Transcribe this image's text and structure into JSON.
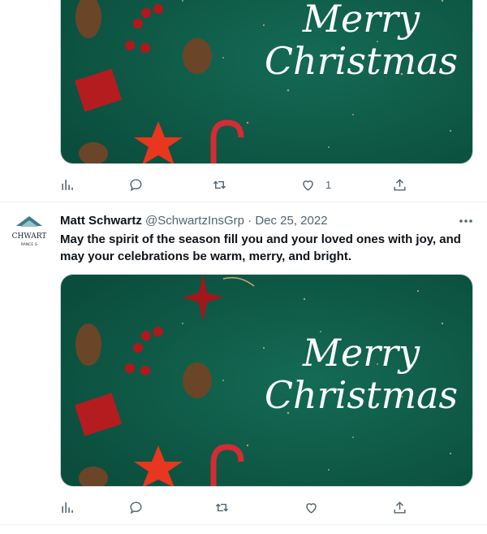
{
  "tweet1": {
    "image_text": [
      "Merry",
      "Christmas"
    ],
    "actions": {
      "analytics_icon": "bar-chart-icon",
      "reply_icon": "speech-bubble-icon",
      "retweet_icon": "retweet-arrows-icon",
      "like_icon": "heart-icon",
      "like_count": "1",
      "share_icon": "upload-arrow-icon"
    }
  },
  "tweet2": {
    "author_name": "Matt Schwartz",
    "handle": "@SchwartzInsGrp",
    "separator": "·",
    "date": "Dec 25, 2022",
    "avatar_text": [
      "CHWART",
      "RANCE G"
    ],
    "text": "May the spirit of the season fill you and your loved ones with joy, and may your celebrations be warm, merry, and bright.",
    "image_text": [
      "Merry",
      "Christmas"
    ],
    "actions": {
      "analytics_icon": "bar-chart-icon",
      "reply_icon": "speech-bubble-icon",
      "retweet_icon": "retweet-arrows-icon",
      "like_icon": "heart-icon",
      "share_icon": "upload-arrow-icon"
    }
  },
  "colors": {
    "card_bg": "#0f5b48",
    "text_primary": "#0f1419",
    "text_secondary": "#536471"
  }
}
